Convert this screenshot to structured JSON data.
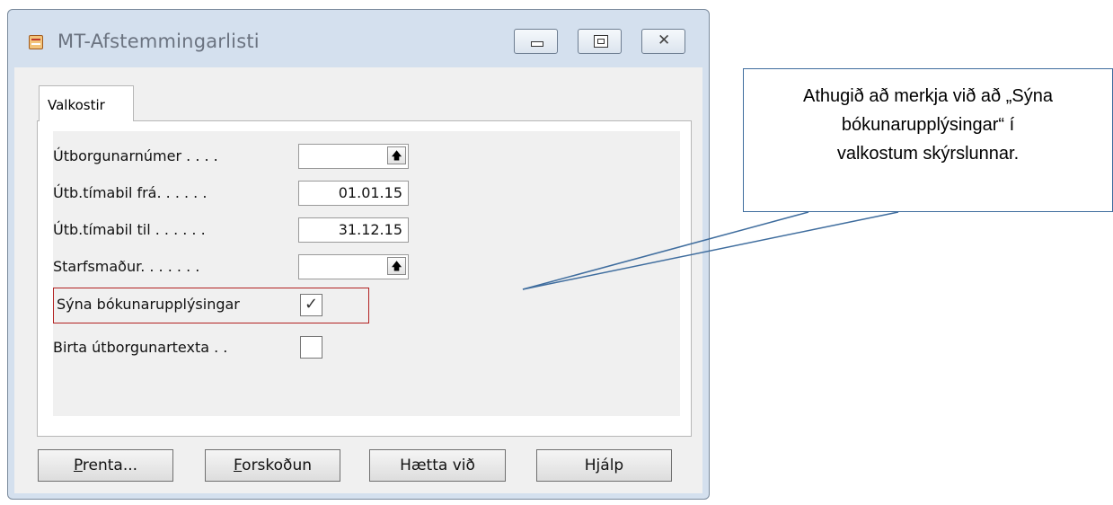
{
  "window": {
    "title": "MT-Afstemmingarlisti",
    "controls": {
      "minimize": "minimize",
      "maximize": "maximize",
      "close": "close"
    }
  },
  "tabs": [
    {
      "label": "Valkostir",
      "active": true
    }
  ],
  "form": {
    "rows": [
      {
        "label": "Útborgunarnúmer . . . .",
        "type": "lookup",
        "value": ""
      },
      {
        "label": "Útb.tímabil frá. . . . . .",
        "type": "text",
        "value": "01.01.15"
      },
      {
        "label": "Útb.tímabil til . . . . . .",
        "type": "text",
        "value": "31.12.15"
      },
      {
        "label": "Starfsmaður. . . . . . .",
        "type": "lookup",
        "value": ""
      },
      {
        "label": "Sýna bókunarupplýsingar",
        "type": "checkbox",
        "checked": true,
        "highlighted": true
      },
      {
        "label": "Birta útborgunartexta . .",
        "type": "checkbox",
        "checked": false
      }
    ]
  },
  "buttons": {
    "print": {
      "underlined": "P",
      "rest": "renta..."
    },
    "preview": {
      "underlined": "F",
      "rest": "orskoðun"
    },
    "cancel": "Hætta við",
    "help": "Hjálp"
  },
  "callout": {
    "lines": [
      "Athugið að merkja við að „Sýna",
      "bókunarupplýsingar“ í",
      "valkostum skýrslunnar."
    ]
  },
  "icons": {
    "lookup": "up-arrow-icon",
    "checkmark": "✓",
    "close_glyph": "✕"
  },
  "colors": {
    "highlight_border": "#b22222",
    "callout_border": "#3f6d9e"
  }
}
